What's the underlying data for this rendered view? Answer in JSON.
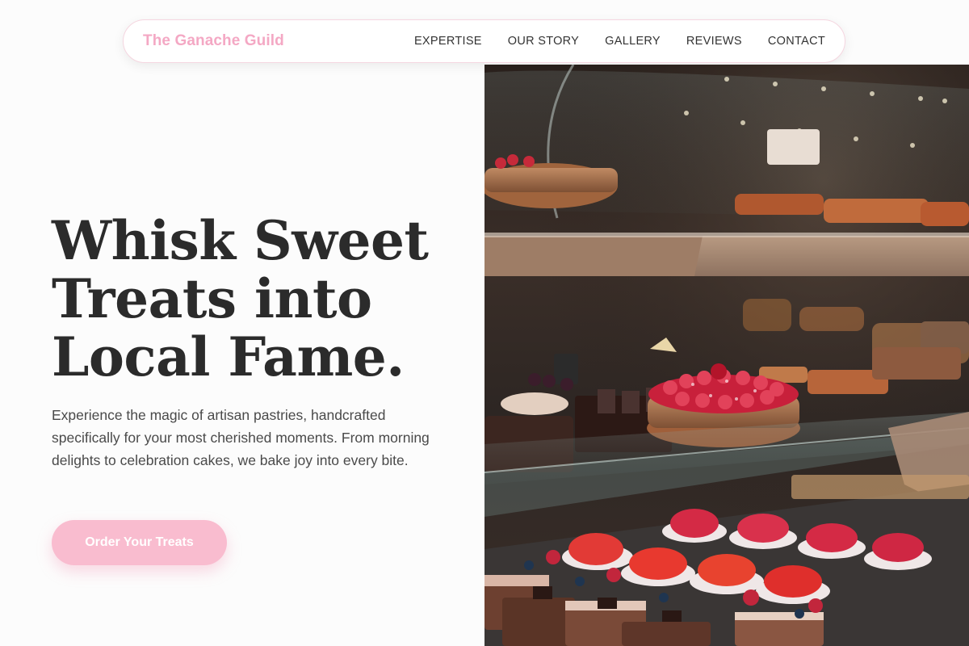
{
  "nav": {
    "brand": "The Ganache Guild",
    "links": [
      "EXPERTISE",
      "OUR STORY",
      "GALLERY",
      "REVIEWS",
      "CONTACT"
    ]
  },
  "hero": {
    "title_line1": "Whisk Sweet",
    "title_line2": "Treats into",
    "title_line3": "Local Fame.",
    "description": "Experience the magic of artisan pastries, handcrafted specifically for your most cherished moments. From morning delights to celebration cakes, we bake joy into every bite.",
    "cta_label": "Order Your Treats"
  },
  "colors": {
    "brand_pink": "#f4a8c4",
    "cta_pink": "#f9bccf",
    "heading": "#2b2b2b",
    "body_text": "#4a4a4a"
  }
}
